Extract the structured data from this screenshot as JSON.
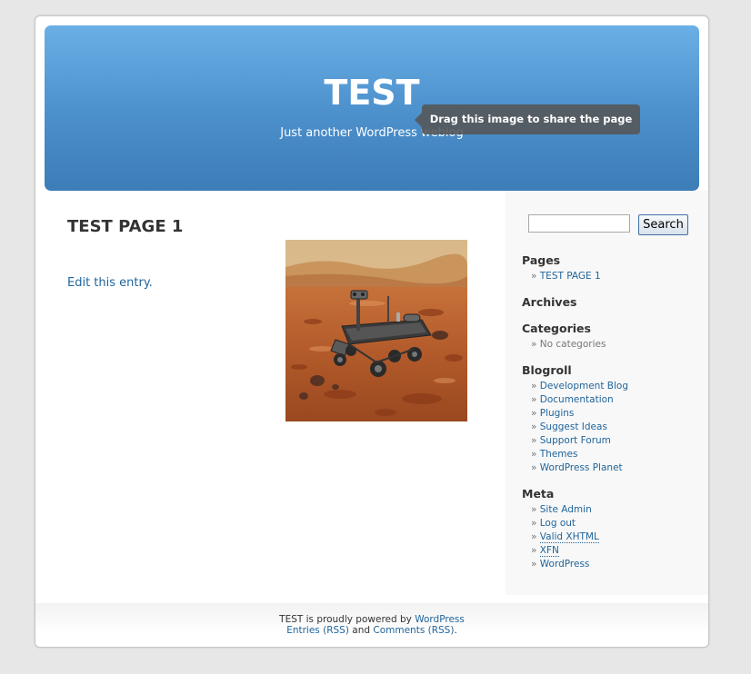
{
  "header": {
    "title": "TEST",
    "description": "Just another WordPress weblog"
  },
  "post": {
    "title": "TEST PAGE 1",
    "edit_link": "Edit this entry.",
    "image_alt": "Mars rover on rocky red terrain"
  },
  "tooltip": {
    "text": "Drag this image to share the page"
  },
  "search": {
    "value": "",
    "button_label": "Search"
  },
  "sidebar": {
    "pages": {
      "heading": "Pages",
      "items": [
        "TEST PAGE 1"
      ]
    },
    "archives": {
      "heading": "Archives"
    },
    "categories": {
      "heading": "Categories",
      "items": [
        "No categories"
      ]
    },
    "blogroll": {
      "heading": "Blogroll",
      "items": [
        "Development Blog",
        "Documentation",
        "Plugins",
        "Suggest Ideas",
        "Support Forum",
        "Themes",
        "WordPress Planet"
      ]
    },
    "meta": {
      "heading": "Meta",
      "items": [
        "Site Admin",
        "Log out",
        "Valid XHTML",
        "XFN",
        "WordPress"
      ]
    }
  },
  "footer": {
    "line1_prefix": "TEST is proudly powered by ",
    "line1_link": "WordPress",
    "entries_link": "Entries (RSS)",
    "and": " and ",
    "comments_link": "Comments (RSS)",
    "end": "."
  },
  "colors": {
    "link": "#21659b",
    "header_top": "#6ab0e6",
    "header_bottom": "#3d7db7"
  }
}
